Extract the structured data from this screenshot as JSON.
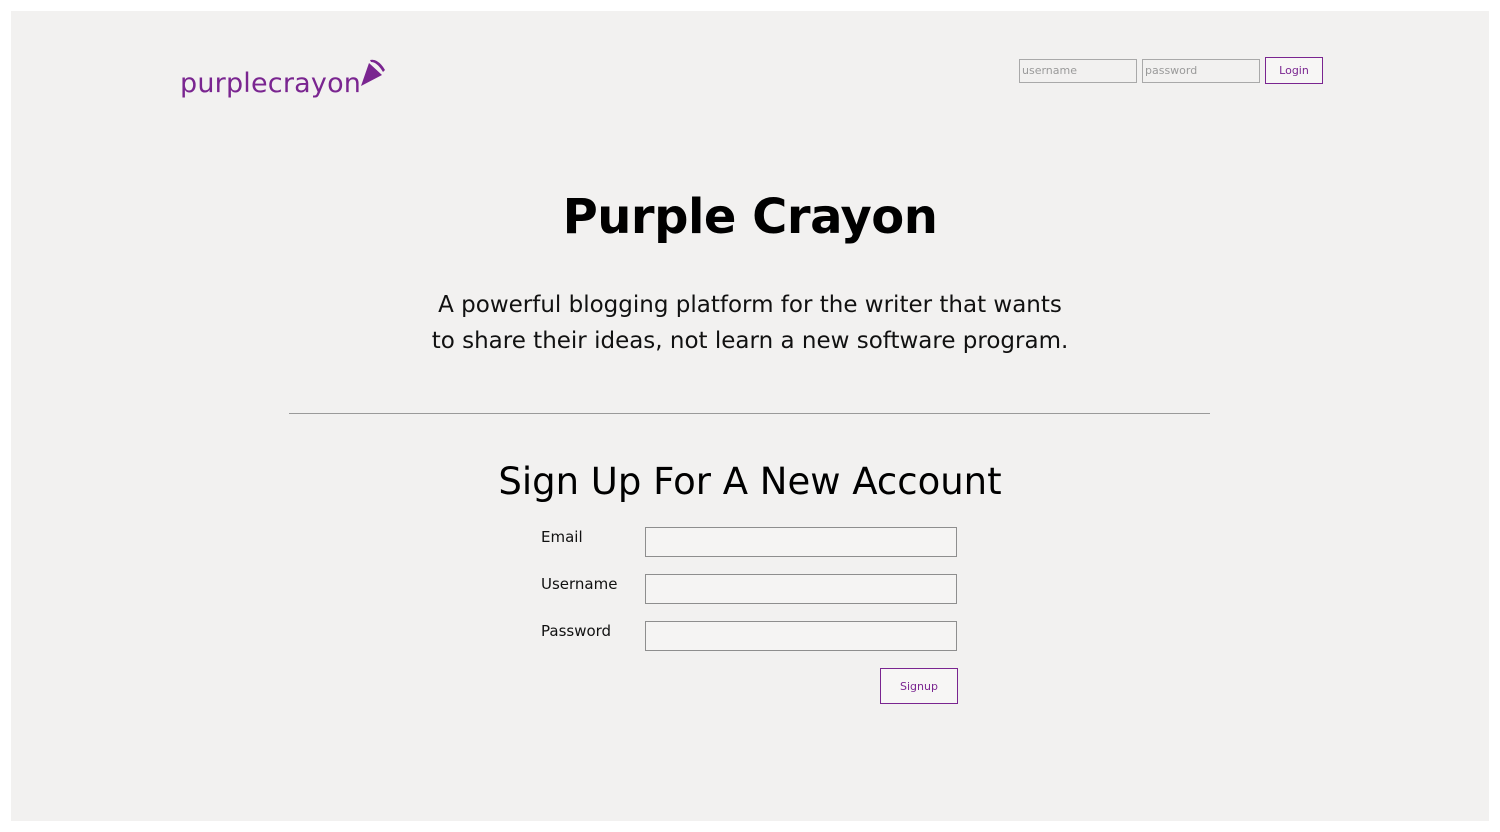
{
  "header": {
    "logo_text": "purplecrayon",
    "username_placeholder": "username",
    "password_placeholder": "password",
    "login_label": "Login"
  },
  "hero": {
    "title": "Purple Crayon",
    "tagline_line1": "A powerful blogging platform for the writer that wants",
    "tagline_line2": "to share their ideas, not learn a new software program."
  },
  "signup": {
    "heading": "Sign Up For A New Account",
    "email_label": "Email",
    "email_value": "",
    "username_label": "Username",
    "username_value": "",
    "password_label": "Password",
    "password_value": "",
    "submit_label": "Signup"
  },
  "colors": {
    "brand": "#7a2590",
    "background": "#f2f1f0"
  }
}
